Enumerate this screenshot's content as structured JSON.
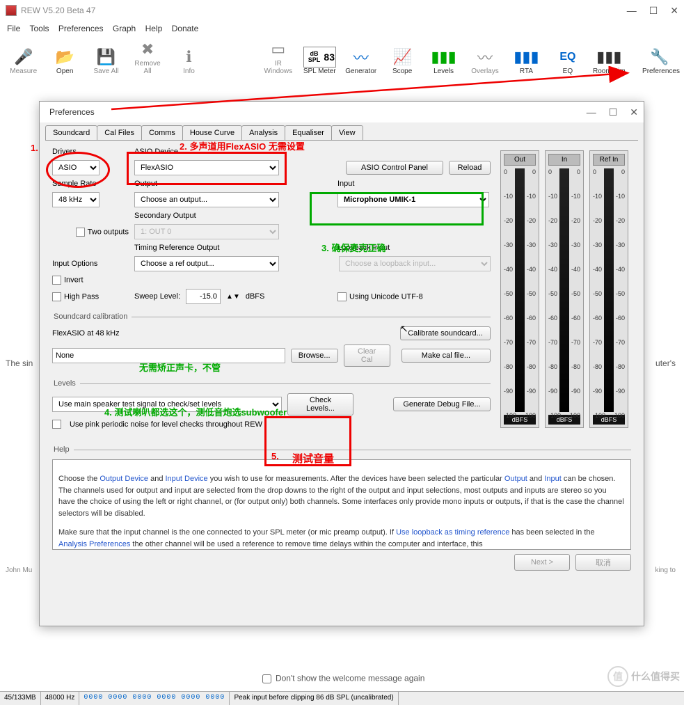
{
  "main": {
    "title": "REW V5.20 Beta 47",
    "menu": [
      "File",
      "Tools",
      "Preferences",
      "Graph",
      "Help",
      "Donate"
    ],
    "toolbar": {
      "measure": "Measure",
      "open": "Open",
      "saveall": "Save All",
      "removeall": "Remove All",
      "info": "Info",
      "irwindows": "IR Windows",
      "splmeter": "SPL Meter",
      "spl_num": "83",
      "spl_label": "dB SPL",
      "generator": "Generator",
      "scope": "Scope",
      "levels": "Levels",
      "overlays": "Overlays",
      "rta": "RTA",
      "eq": "EQ",
      "roomsim": "Room Sim",
      "preferences": "Preferences"
    }
  },
  "bg": {
    "left": "The sin",
    "right": "uter's",
    "john": "John Mu",
    "king": "king to"
  },
  "prefs": {
    "title": "Preferences",
    "tabs": [
      "Soundcard",
      "Cal Files",
      "Comms",
      "House Curve",
      "Analysis",
      "Equaliser",
      "View"
    ],
    "drivers_lbl": "Drivers",
    "drivers_val": "ASIO",
    "asiodev_lbl": "ASIO Device",
    "asiodev_val": "FlexASIO",
    "asio_panel": "ASIO Control Panel",
    "reload": "Reload",
    "samplerate_lbl": "Sample Rate",
    "samplerate_val": "48 kHz",
    "output_lbl": "Output",
    "output_val": "Choose an output...",
    "input_lbl": "Input",
    "input_val": "Microphone UMIK-1",
    "secout_lbl": "Secondary Output",
    "twoout": "Two outputs",
    "secout_val": "1: OUT 0",
    "timref_lbl": "Timing Reference Output",
    "timref_val": "Choose a ref output...",
    "loopback_lbl": "Loopback Input",
    "loopback_val": "Choose a loopback input...",
    "inputopt_lbl": "Input Options",
    "invert": "Invert",
    "highpass": "High Pass",
    "sweep_lbl": "Sweep Level:",
    "sweep_val": "-15.0",
    "dbfs": "dBFS",
    "utf8": "Using Unicode UTF-8",
    "cal_section": "Soundcard calibration",
    "cal_text": "FlexASIO at 48 kHz",
    "cal_val": "None",
    "browse": "Browse...",
    "clearcal": "Clear Cal",
    "cal_soundcard": "Calibrate soundcard...",
    "makecal": "Make cal file...",
    "levels_section": "Levels",
    "levels_val": "Use main speaker test signal to check/set levels",
    "checklevels": "Check Levels...",
    "gendebug": "Generate Debug File...",
    "pinknoise": "Use pink periodic noise for level checks throughout REW",
    "help_section": "Help",
    "help1a": "Choose the ",
    "help1b": "Output Device",
    "help1c": " and ",
    "help1d": "Input Device",
    "help1e": " you wish to use for measurements. After the devices have been selected the particular ",
    "help1f": "Output",
    "help1g": " and ",
    "help1h": "Input",
    "help1i": " can be chosen. The channels used for output and input are selected from the drop downs to the right of the output and input selections, most outputs and inputs are stereo so you have the choice of using the left or right channel, or (for output only) both channels. Some interfaces only provide mono inputs or outputs, if that is the case the channel selectors will be disabled.",
    "help2a": "Make sure that the input channel is the one connected to your SPL meter (or mic preamp output). If ",
    "help2b": "Use loopback as timing reference",
    "help2c": " has been selected in the ",
    "help2d": "Analysis Preferences",
    "help2e": " the other channel will be used a reference to remove time delays within the computer and interface, this ",
    "next": "Next >",
    "cancel": "取消",
    "meters": {
      "out": "Out",
      "in": "In",
      "refin": "Ref In",
      "unit": "dBFS",
      "ticks": [
        "0",
        "-10",
        "-20",
        "-30",
        "-40",
        "-50",
        "-60",
        "-70",
        "-80",
        "-90",
        "-100"
      ]
    }
  },
  "ann": {
    "n1": "1.",
    "n2": "2. 多声道用FlexASIO 无需设置",
    "n3": "3. 确保麦克正确",
    "n4": "无需矫正声卡，不管",
    "n4b": "4.  测试喇叭都选这个，测低音炮选subwoofer",
    "n5": "5.",
    "n5b": "测试音量"
  },
  "welcome": "Don't show the welcome message again",
  "status": {
    "mem": "45/133MB",
    "hz": "48000 Hz",
    "digits": "0000 0000  0000 0000  0000 0000",
    "clip": "Peak input before clipping 86 dB SPL (uncalibrated)"
  },
  "watermark": {
    "zhi": "值",
    "text": "什么值得买"
  }
}
